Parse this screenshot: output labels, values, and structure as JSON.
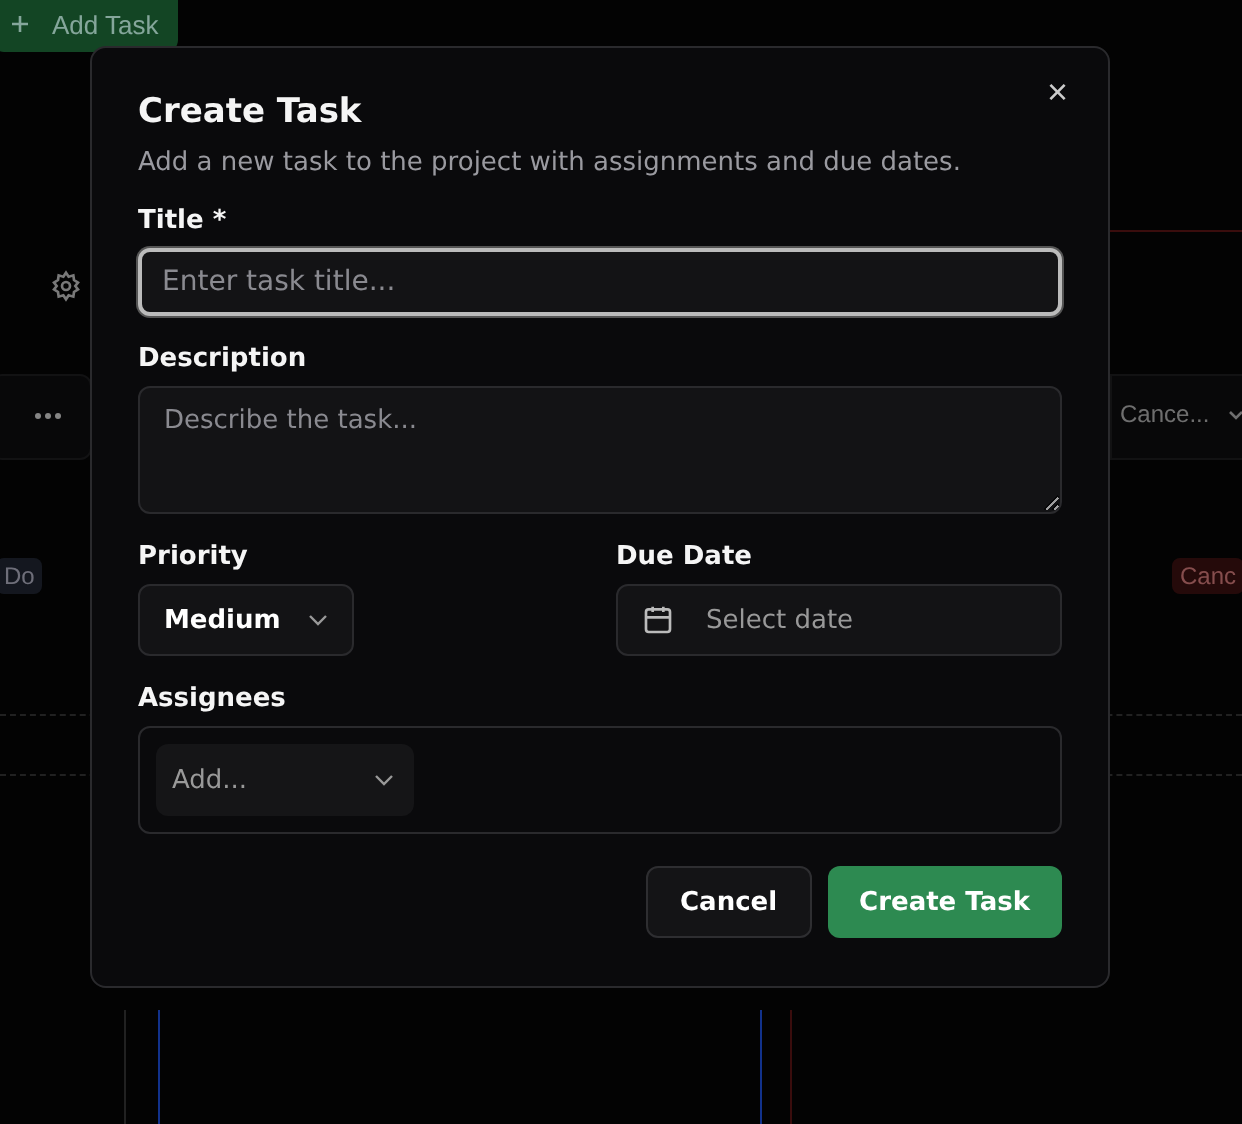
{
  "background": {
    "add_button": {
      "label": "Add Task"
    },
    "left_badge": "Do",
    "right_select": "Cance...",
    "right_badge": "Canc"
  },
  "dialog": {
    "title": "Create Task",
    "close": "×",
    "description": "Add a new task to the project with assignments and due dates.",
    "title_field": {
      "label": "Title *",
      "placeholder": "Enter task title..."
    },
    "description_field": {
      "label": "Description",
      "placeholder": "Describe the task..."
    },
    "priority": {
      "label": "Priority",
      "value": "Medium"
    },
    "due_date": {
      "label": "Due Date",
      "placeholder": "Select date"
    },
    "assignees": {
      "label": "Assignees",
      "placeholder": "Add..."
    },
    "buttons": [
      {
        "kind": "secondary",
        "label": "Cancel"
      },
      {
        "kind": "primary",
        "label": "Create Task"
      }
    ]
  }
}
